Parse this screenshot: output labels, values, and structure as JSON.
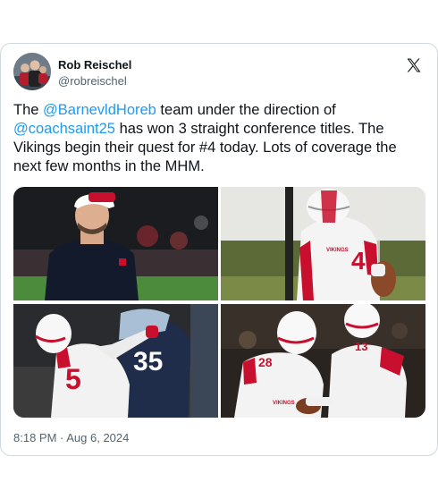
{
  "tweet": {
    "author_name": "Rob Reischel",
    "author_handle": "@robreischel",
    "text_parts": {
      "p1": "The ",
      "mention1": "@BarnevldHoreb",
      "p2": " team under the direction of ",
      "mention2": "@coachsaint25",
      "p3": " has won 3 straight conference titles. The Vikings begin their quest for #4 today. Lots of coverage the next few months in the MHM."
    },
    "timestamp": "8:18 PM · Aug 6, 2024"
  },
  "icons": {
    "logo": "x-logo-icon"
  },
  "colors": {
    "link": "#1d9bf0",
    "text": "#0f1419",
    "muted": "#536471",
    "team_red": "#c8102e",
    "opponent_navy": "#1f2d4a"
  },
  "jerseys": {
    "photo2_number": "4",
    "photo2_chest": "VIKINGS",
    "photo3_number": "5",
    "photo3_opponent_number": "35",
    "photo4_left_number": "28",
    "photo4_right_number": "13",
    "photo4_chest": "VIKINGS"
  }
}
